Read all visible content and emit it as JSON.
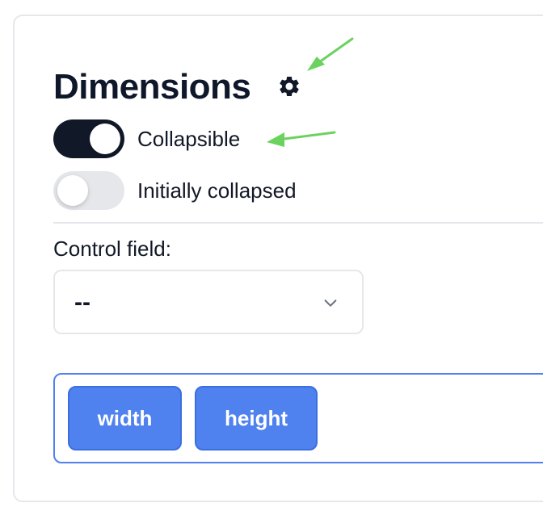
{
  "section": {
    "title": "Dimensions",
    "settings_icon": "gear-icon"
  },
  "toggles": [
    {
      "label": "Collapsible",
      "checked": true
    },
    {
      "label": "Initially collapsed",
      "checked": false
    }
  ],
  "control_field": {
    "label": "Control field:",
    "selected": "--",
    "icon": "chevron-down-icon"
  },
  "fields": [
    {
      "label": "width"
    },
    {
      "label": "height"
    }
  ],
  "colors": {
    "title": "#0f172a",
    "toggle_on": "#111827",
    "toggle_off": "#e5e7eb",
    "chip": "#4f82ee",
    "fields_border": "#4f7ff0",
    "annotation_arrow": "#6bd25f"
  }
}
